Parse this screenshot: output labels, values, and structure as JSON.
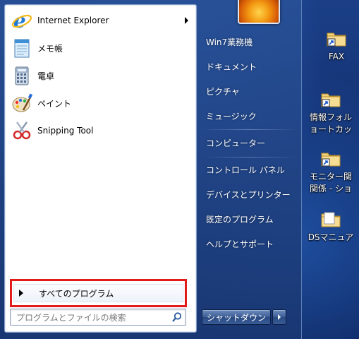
{
  "colors": {
    "highlight_box": "#e21b1b",
    "menu_glass": "#1f4a96"
  },
  "pinned": [
    {
      "label": "Internet Explorer",
      "icon": "internet-explorer-icon",
      "has_submenu": true
    },
    {
      "label": "メモ帳",
      "icon": "notepad-icon"
    },
    {
      "label": "電卓",
      "icon": "calculator-icon"
    },
    {
      "label": "ペイント",
      "icon": "paint-icon"
    },
    {
      "label": "Snipping Tool",
      "icon": "scissors-icon"
    }
  ],
  "all_programs": {
    "label": "すべてのプログラム"
  },
  "search": {
    "placeholder": "プログラムとファイルの検索",
    "value": ""
  },
  "right_menu": [
    {
      "label": "Win7業務機"
    },
    {
      "label": "ドキュメント"
    },
    {
      "label": "ピクチャ"
    },
    {
      "label": "ミュージック"
    },
    {
      "label": "コンピューター"
    },
    {
      "label": "コントロール パネル"
    },
    {
      "label": "デバイスとプリンター"
    },
    {
      "label": "既定のプログラム"
    },
    {
      "label": "ヘルプとサポート"
    }
  ],
  "shutdown": {
    "label": "シャットダウン"
  },
  "desktop_icons": [
    {
      "label1": "FAX",
      "label2": ""
    },
    {
      "label1": "情報フォル",
      "label2": "ョートカッ"
    },
    {
      "label1": "モニター関",
      "label2": "関係 - ショ"
    },
    {
      "label1": "DSマニュア",
      "label2": ""
    }
  ]
}
